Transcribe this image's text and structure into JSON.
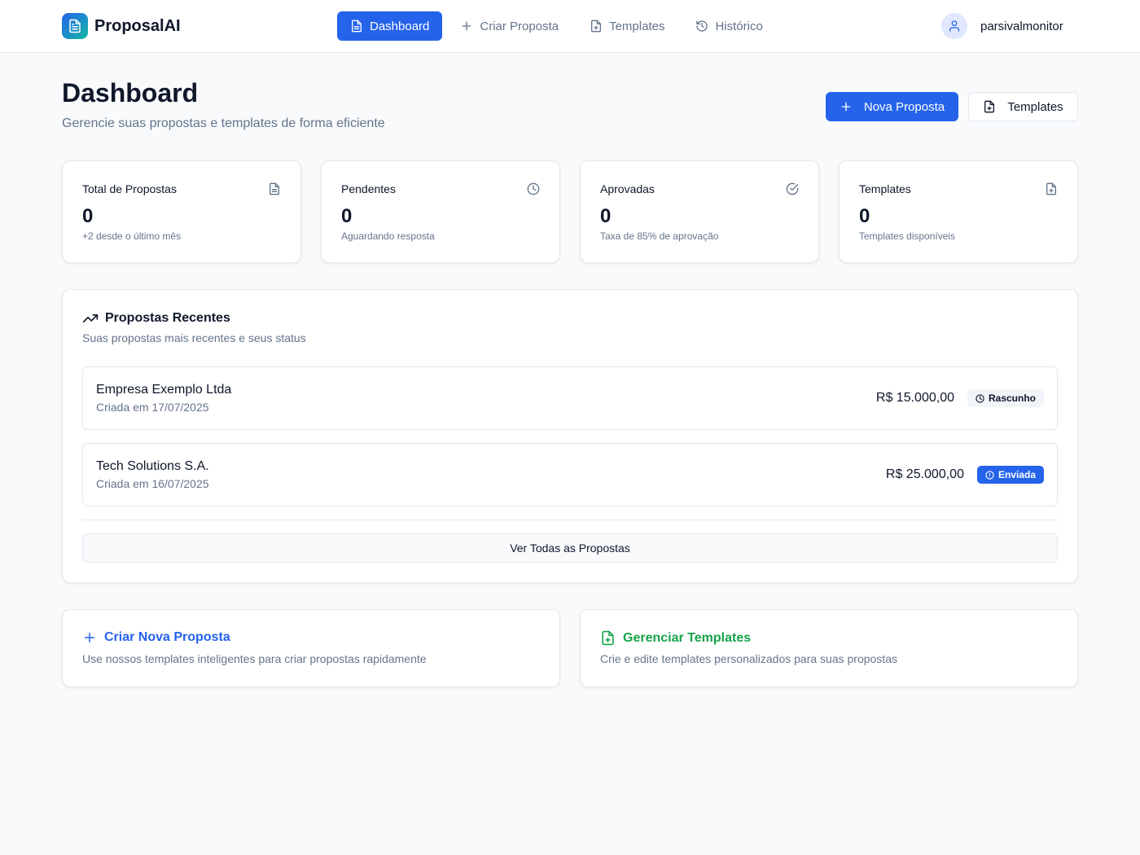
{
  "app": {
    "name": "ProposalAI",
    "logo_icon": "file-text-icon"
  },
  "nav": {
    "items": [
      {
        "label": "Dashboard",
        "icon": "file-text-icon",
        "active": true
      },
      {
        "label": "Criar Proposta",
        "icon": "plus-icon",
        "active": false
      },
      {
        "label": "Templates",
        "icon": "file-plus-icon",
        "active": false
      },
      {
        "label": "Histórico",
        "icon": "history-icon",
        "active": false
      }
    ]
  },
  "user": {
    "name": "parsivalmonitor",
    "icon": "user-icon"
  },
  "page": {
    "title": "Dashboard",
    "subtitle": "Gerencie suas propostas e templates de forma eficiente",
    "new_button": "Nova Proposta",
    "templates_button": "Templates"
  },
  "stats": [
    {
      "title": "Total de Propostas",
      "value": "0",
      "sub": "+2 desde o último mês",
      "icon": "file-text-icon"
    },
    {
      "title": "Pendentes",
      "value": "0",
      "sub": "Aguardando resposta",
      "icon": "clock-icon"
    },
    {
      "title": "Aprovadas",
      "value": "0",
      "sub": "Taxa de 85% de aprovação",
      "icon": "check-circle-icon"
    },
    {
      "title": "Templates",
      "value": "0",
      "sub": "Templates disponíveis",
      "icon": "file-plus-icon"
    }
  ],
  "recent": {
    "title": "Propostas Recentes",
    "subtitle": "Suas propostas mais recentes e seus status",
    "icon": "trending-up-icon",
    "items": [
      {
        "company": "Empresa Exemplo Ltda",
        "date": "Criada em 17/07/2025",
        "amount": "R$ 15.000,00",
        "status": "Rascunho",
        "status_icon": "clock-icon"
      },
      {
        "company": "Tech Solutions S.A.",
        "date": "Criada em 16/07/2025",
        "amount": "R$ 25.000,00",
        "status": "Enviada",
        "status_icon": "alert-circle-icon"
      }
    ],
    "view_all": "Ver Todas as Propostas"
  },
  "actions": [
    {
      "title": "Criar Nova Proposta",
      "sub": "Use nossos templates inteligentes para criar propostas rapidamente",
      "icon": "plus-icon",
      "color": "#2563eb"
    },
    {
      "title": "Gerenciar Templates",
      "sub": "Crie e edite templates personalizados para suas propostas",
      "icon": "file-plus-icon",
      "color": "#16a34a"
    }
  ],
  "colors": {
    "primary": "#2563eb",
    "success": "#16a34a",
    "muted": "#64748b"
  }
}
